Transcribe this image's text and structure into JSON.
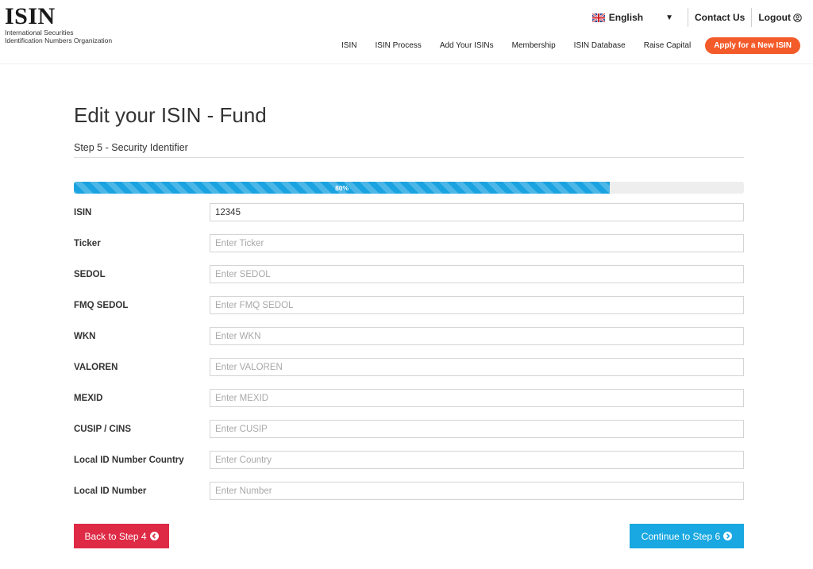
{
  "header": {
    "logo_text": "ISIN",
    "logo_subtitle_line1": "International Securities",
    "logo_subtitle_line2": "Identification Numbers Organization",
    "language": "English",
    "contact_us": "Contact Us",
    "logout": "Logout",
    "nav": [
      "ISIN",
      "ISIN Process",
      "Add Your ISINs",
      "Membership",
      "ISIN Database",
      "Raise Capital"
    ],
    "cta": "Apply for a New ISIN",
    "cta_color": "#f35b2a"
  },
  "page": {
    "title": "Edit your ISIN - Fund",
    "step_label": "Step 5 - Security Identifier",
    "progress_percent": 80,
    "progress_text": "80%",
    "progress_color": "#1aa3e0"
  },
  "form": {
    "fields": [
      {
        "label": "ISIN",
        "value": "12345",
        "placeholder": ""
      },
      {
        "label": "Ticker",
        "value": "",
        "placeholder": "Enter Ticker"
      },
      {
        "label": "SEDOL",
        "value": "",
        "placeholder": "Enter SEDOL"
      },
      {
        "label": "FMQ SEDOL",
        "value": "",
        "placeholder": "Enter FMQ SEDOL"
      },
      {
        "label": "WKN",
        "value": "",
        "placeholder": "Enter WKN"
      },
      {
        "label": "VALOREN",
        "value": "",
        "placeholder": "Enter VALOREN"
      },
      {
        "label": "MEXID",
        "value": "",
        "placeholder": "Enter MEXID"
      },
      {
        "label": "CUSIP / CINS",
        "value": "",
        "placeholder": "Enter CUSIP"
      },
      {
        "label": "Local ID Number Country",
        "value": "",
        "placeholder": "Enter Country"
      },
      {
        "label": "Local ID Number",
        "value": "",
        "placeholder": "Enter Number"
      }
    ]
  },
  "actions": {
    "back_label": "Back to Step 4",
    "back_color": "#de2a45",
    "next_label": "Continue to Step 6",
    "next_color": "#19a8e1"
  },
  "icons": {
    "flag": "uk-flag-icon",
    "caret": "caret-down-icon",
    "user": "user-circle-icon",
    "back": "arrow-circle-left-icon",
    "next": "arrow-circle-right-icon"
  }
}
